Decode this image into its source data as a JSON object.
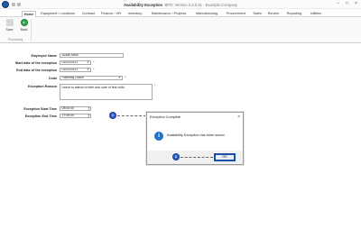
{
  "window": {
    "title": "Availability Exception",
    "subtitle": "BPO: Version 2.4.0.31 - Example Company",
    "minimize": "–",
    "maximize": "□",
    "close": "×"
  },
  "ribbon_tabs": [
    "Home",
    "Equipment / Locations",
    "Contract",
    "Finance / HR",
    "Inventory",
    "Maintenance / Projects",
    "Manufacturing",
    "Procurement",
    "Sales",
    "Service",
    "Reporting",
    "Utilities"
  ],
  "ribbon": {
    "save_label": "Save",
    "back_label": "Back",
    "group_label": "Processing"
  },
  "form": {
    "employee_name_label": "Employee Name",
    "employee_name_value": "Judah Mbhi",
    "start_date_label": "Start date of the exception",
    "start_date_value": "01/02/2021",
    "end_date_label": "End date of the exception",
    "end_date_value": "01/02/2021",
    "code_label": "Code",
    "code_value": "Paternity Leave",
    "reason_label": "Exception Reason",
    "reason_value": "Leave to attend to birth and care of first child.",
    "start_time_label": "Exception Start Time",
    "start_time_value": "08:00:00",
    "end_time_label": "Exception End Time",
    "end_time_value": "17:00:00",
    "required_mark": "*"
  },
  "callouts": {
    "one": "1",
    "two": "2"
  },
  "dialog": {
    "title": "Exception Complete",
    "close": "×",
    "info_glyph": "i",
    "message": "Availability Exception has been saved.",
    "ok_label": "OK"
  },
  "colors": {
    "accent": "#1e5aa8",
    "callout": "#2f5fcc",
    "required": "#dd0000",
    "back_button": "#34a84a"
  }
}
